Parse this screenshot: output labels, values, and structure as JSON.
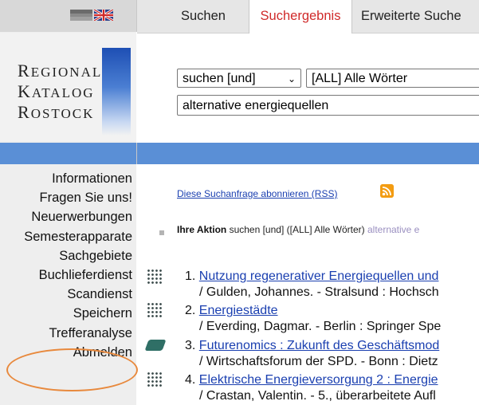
{
  "language": {
    "current_flag": "de-flag-icon",
    "alt_flag": "uk-flag-icon"
  },
  "logo": {
    "line1_cap": "R",
    "line1_rest": "EGIONAL",
    "line2_cap": "K",
    "line2_rest": "ATALOG",
    "line3_cap": "R",
    "line3_rest": "OSTOCK"
  },
  "tabs": [
    {
      "label": "Suchen"
    },
    {
      "label": "Suchergebnis"
    },
    {
      "label": "Erweiterte Suche"
    }
  ],
  "search": {
    "mode": "suchen [und]",
    "field": "[ALL] Alle Wörter",
    "query": "alternative energiequellen"
  },
  "sidebar": {
    "items": [
      {
        "label": "Informationen"
      },
      {
        "label": "Fragen Sie uns!"
      },
      {
        "label": "Neuerwerbungen"
      },
      {
        "label": "Semesterapparate"
      },
      {
        "label": "Sachgebiete"
      },
      {
        "label": "Buchlieferdienst"
      },
      {
        "label": "Scandienst"
      },
      {
        "label": "Speichern"
      },
      {
        "label": "Trefferanalyse"
      },
      {
        "label": "Abmelden"
      }
    ]
  },
  "rss": {
    "label": "Diese Suchanfrage abonnieren (RSS)"
  },
  "action": {
    "label": "Ihre Aktion",
    "text": " suchen [und] ([ALL] Alle Wörter) ",
    "keyword": "alternative e"
  },
  "results": [
    {
      "num": "1. ",
      "title": "Nutzung regenerativer Energiequellen und",
      "detail": "/ Gulden, Johannes. - Stralsund : Hochsch",
      "icon": "text-document-icon"
    },
    {
      "num": "2. ",
      "title": "Energiestädte",
      "detail": "/ Everding, Dagmar. - Berlin : Springer Spe",
      "icon": "text-document-icon"
    },
    {
      "num": "3. ",
      "title": "Futurenomics : Zukunft des Geschäftsmod",
      "detail": "/ Wirtschaftsforum der SPD. - Bonn : Dietz",
      "icon": "book-icon"
    },
    {
      "num": "4. ",
      "title": "Elektrische Energieversorgung 2 : Energie",
      "detail": "/ Crastan, Valentin. - 5., überarbeitete Aufl",
      "icon": "text-document-icon"
    }
  ]
}
